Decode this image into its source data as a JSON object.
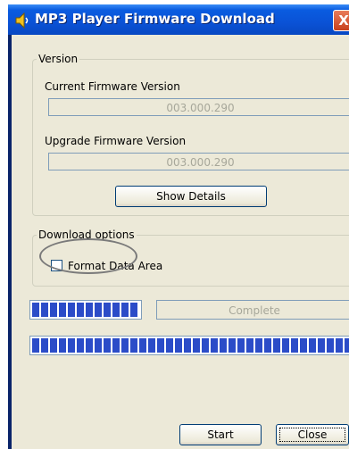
{
  "window": {
    "title": "MP3 Player Firmware Download",
    "close_glyph": "X"
  },
  "version_group": {
    "label": "Version",
    "current_label": "Current Firmware Version",
    "current_value": "003.000.290",
    "upgrade_label": "Upgrade Firmware Version",
    "upgrade_value": "003.000.290",
    "show_details_label": "Show Details"
  },
  "download_group": {
    "label": "Download options",
    "format_label": "Format Data Area",
    "format_checked": false
  },
  "progress": {
    "status_text": "Complete",
    "small_bar_fraction": 1.0,
    "big_bar_fraction": 1.0
  },
  "buttons": {
    "start_label": "Start",
    "close_label": "Close"
  },
  "icons": {
    "title_icon": "speaker-icon"
  }
}
